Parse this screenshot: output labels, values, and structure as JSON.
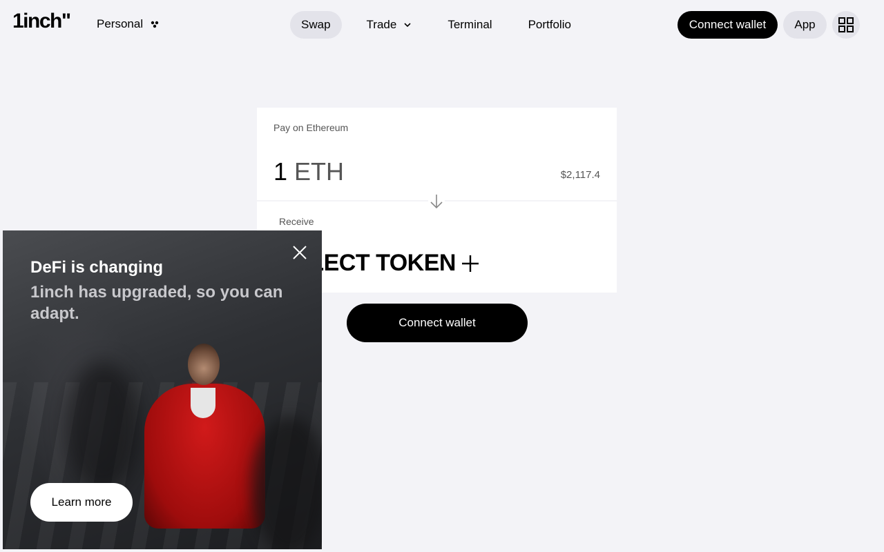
{
  "header": {
    "logo": "1inch\"",
    "account_mode": "Personal",
    "nav": [
      {
        "label": "Swap",
        "active": true
      },
      {
        "label": "Trade",
        "has_dropdown": true
      },
      {
        "label": "Terminal"
      },
      {
        "label": "Portfolio"
      }
    ],
    "connect_wallet": "Connect wallet",
    "app_label": "App",
    "grid_icon": "grid-menu-icon"
  },
  "swap": {
    "pay_label": "Pay on Ethereum",
    "amount": "1",
    "token": "ETH",
    "usd_value": "$2,117.4",
    "receive_label": "Receive",
    "select_token": "SELECT TOKEN",
    "connect_wallet": "Connect wallet"
  },
  "promo": {
    "title": "DeFi is changing",
    "subtitle": "1inch has upgraded, so you can adapt.",
    "cta": "Learn more"
  }
}
